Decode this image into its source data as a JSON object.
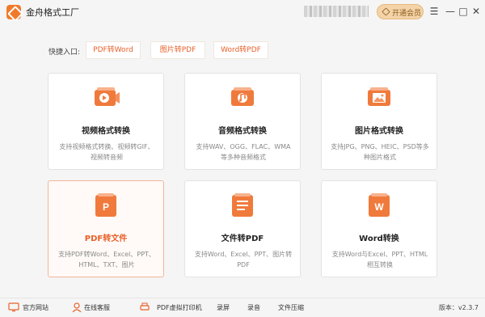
{
  "app": {
    "title": "金舟格式工厂"
  },
  "header": {
    "vip_label": "开通会员",
    "menu_glyph": "☰",
    "minimize_glyph": "—",
    "maximize_glyph": "□",
    "close_glyph": "✕"
  },
  "quick": {
    "label": "快捷入口:",
    "buttons": [
      "PDF转Word",
      "图片转PDF",
      "Word转PDF"
    ]
  },
  "cards": [
    {
      "title": "视频格式转换",
      "desc": "支持视频格式转换、视频转GIF、视频转音频",
      "icon": "video-icon"
    },
    {
      "title": "音频格式转换",
      "desc": "支持WAV、OGG、FLAC、WMA等多种音频格式",
      "icon": "audio-icon"
    },
    {
      "title": "图片格式转换",
      "desc": "支持JPG、PNG、HEIC、PSD等多种图片格式",
      "icon": "image-icon"
    },
    {
      "title": "PDF转文件",
      "desc": "支持PDF转Word、Excel、PPT、HTML、TXT、图片",
      "icon": "pdf-icon"
    },
    {
      "title": "文件转PDF",
      "desc": "支持Word、Excel、PPT、图片转PDF",
      "icon": "document-icon"
    },
    {
      "title": "Word转换",
      "desc": "支持Word与Excel、PPT、HTML相互转换",
      "icon": "word-icon"
    }
  ],
  "footer": {
    "items": [
      "官方网站",
      "在线客服",
      "PDF虚拟打印机",
      "录屏",
      "录音",
      "文件压缩"
    ],
    "version": "版本：v2.3.7"
  },
  "colors": {
    "accent": "#e8602a",
    "card_border": "#e3e3e3"
  }
}
